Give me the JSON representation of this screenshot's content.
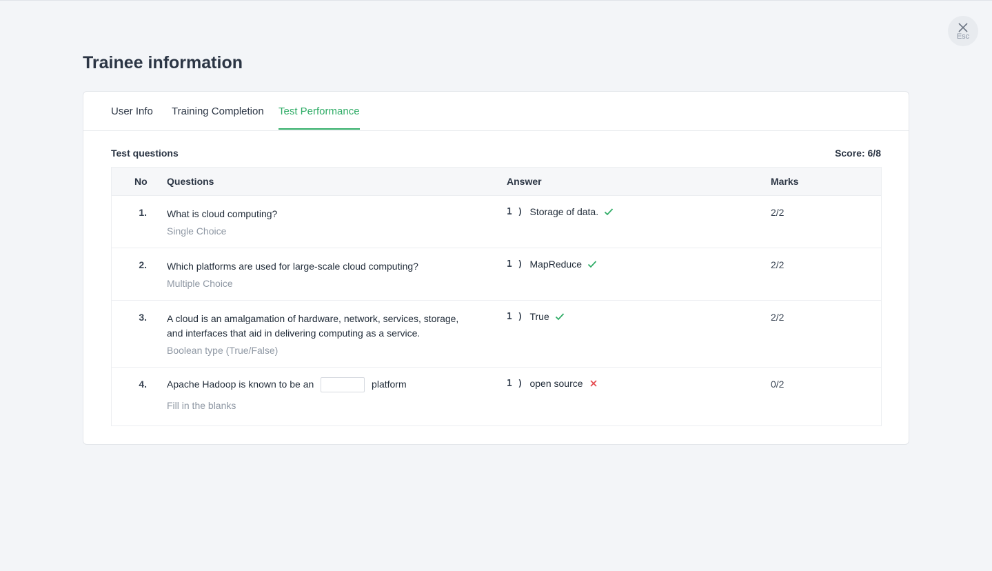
{
  "close": {
    "label": "Esc",
    "icon": "close-icon"
  },
  "page_title": "Trainee information",
  "tabs": [
    {
      "label": "User Info",
      "active": false
    },
    {
      "label": "Training Completion",
      "active": false
    },
    {
      "label": "Test Performance",
      "active": true
    }
  ],
  "section_title": "Test questions",
  "score": "Score: 6/8",
  "columns": {
    "no": "No",
    "questions": "Questions",
    "answer": "Answer",
    "marks": "Marks"
  },
  "rows": [
    {
      "no": "1.",
      "question": "What is cloud computing?",
      "type": "Single Choice",
      "answer_index": "1 )",
      "answer": "Storage of data.",
      "correct": true,
      "marks": "2/2"
    },
    {
      "no": "2.",
      "question": "Which platforms are used for large-scale cloud computing?",
      "type": "Multiple Choice",
      "answer_index": "1 )",
      "answer": "MapReduce",
      "correct": true,
      "marks": "2/2"
    },
    {
      "no": "3.",
      "question": "A cloud is an amalgamation of hardware, network, services, storage, and interfaces that aid in delivering computing as a service.",
      "type": "Boolean type (True/False)",
      "answer_index": "1 )",
      "answer": "True",
      "correct": true,
      "marks": "2/2"
    },
    {
      "no": "4.",
      "question_before": "Apache Hadoop is known to be an",
      "question_after": "platform",
      "blank_value": "",
      "type": "Fill in the blanks",
      "answer_index": "1 )",
      "answer": "open source",
      "correct": false,
      "marks": "0/2"
    }
  ],
  "colors": {
    "accent": "#2fac66",
    "wrong": "#e5484d"
  }
}
